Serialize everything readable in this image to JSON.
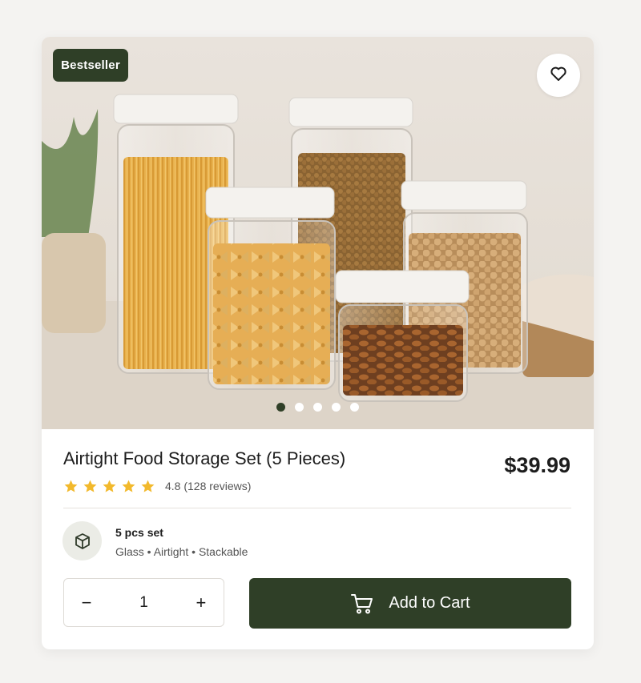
{
  "badge": "Bestseller",
  "gallery": {
    "slides": 5,
    "active_index": 0
  },
  "product": {
    "title": "Airtight Food Storage Set (5 Pieces)",
    "price": "$39.99",
    "rating": 4.8,
    "rating_text": "4.8 (128 reviews)"
  },
  "spec": {
    "title": "5 pcs set",
    "details": "Glass • Airtight • Stackable"
  },
  "quantity": {
    "value": "1",
    "minus": "−",
    "plus": "+"
  },
  "cart": {
    "label": "Add to Cart"
  },
  "icons": {
    "favorite": "heart-icon",
    "spec": "box-icon",
    "cart": "cart-icon",
    "star": "star-icon"
  },
  "colors": {
    "accent": "#2f3f27",
    "star": "#f2b92c",
    "text": "#1d1d1d",
    "muted": "#555555"
  }
}
